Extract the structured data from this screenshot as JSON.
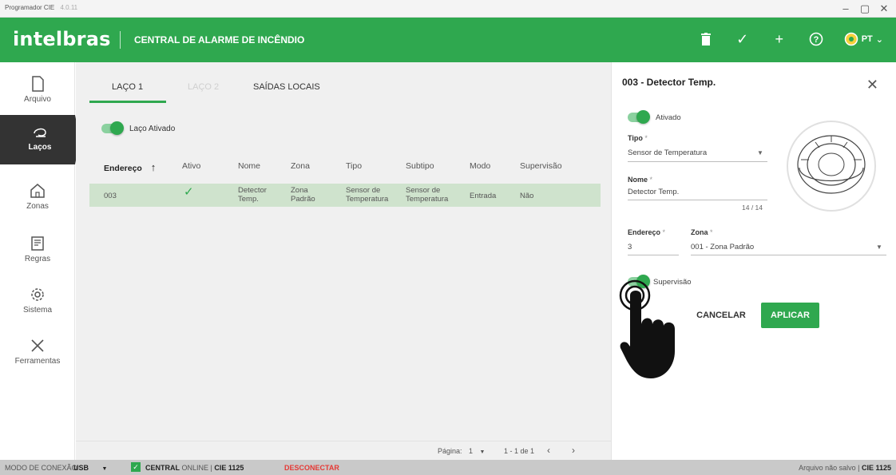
{
  "window": {
    "title": "Programador CIE",
    "version": "4.0.11"
  },
  "header": {
    "brand": "intelbras",
    "title": "CENTRAL DE ALARME DE INCÊNDIO",
    "language": "PT"
  },
  "nav": [
    {
      "label": "Arquivo",
      "icon": "file-icon"
    },
    {
      "label": "Laços",
      "icon": "loop-icon",
      "active": true
    },
    {
      "label": "Zonas",
      "icon": "home-icon"
    },
    {
      "label": "Regras",
      "icon": "rules-icon"
    },
    {
      "label": "Sistema",
      "icon": "gear-icon"
    },
    {
      "label": "Ferramentas",
      "icon": "tools-icon"
    }
  ],
  "tabs": [
    {
      "label": "LAÇO 1",
      "active": true
    },
    {
      "label": "LAÇO 2",
      "disabled": true
    },
    {
      "label": "SAÍDAS LOCAIS"
    }
  ],
  "loop_toggle_label": "Laço Ativado",
  "table": {
    "columns": [
      "Endereço",
      "Ativo",
      "Nome",
      "Zona",
      "Tipo",
      "Subtipo",
      "Modo",
      "Supervisão"
    ],
    "rows": [
      {
        "endereco": "003",
        "ativo": "✓",
        "nome": "Detector Temp.",
        "zona": "Zona Padrão",
        "tipo": "Sensor de Temperatura",
        "subtipo": "Sensor de Temperatura",
        "modo": "Entrada",
        "supervisao": "Não"
      }
    ]
  },
  "pager": {
    "label": "Página:",
    "page": "1",
    "range": "1 - 1 de 1"
  },
  "panel": {
    "title": "003 - Detector Temp.",
    "active_label": "Ativado",
    "tipo_label": "Tipo",
    "tipo_value": "Sensor de Temperatura",
    "nome_label": "Nome",
    "nome_value": "Detector Temp.",
    "nome_counter": "14 / 14",
    "endereco_label": "Endereço",
    "endereco_value": "3",
    "zona_label": "Zona",
    "zona_value": "001 - Zona Padrão",
    "supervisao_label": "Supervisão",
    "cancel": "CANCELAR",
    "apply": "APLICAR"
  },
  "status": {
    "mode_label": "MODO DE CONEXÃO:",
    "mode_value": "USB",
    "central": "CENTRAL",
    "online": "ONLINE |",
    "model": "CIE 1125",
    "disconnect": "DESCONECTAR",
    "file_state": "Arquivo não salvo |",
    "file_model": "CIE 1125"
  },
  "colors": {
    "accent": "#2fa84f",
    "row_selected": "#cfe3cd",
    "danger": "#e53935"
  }
}
